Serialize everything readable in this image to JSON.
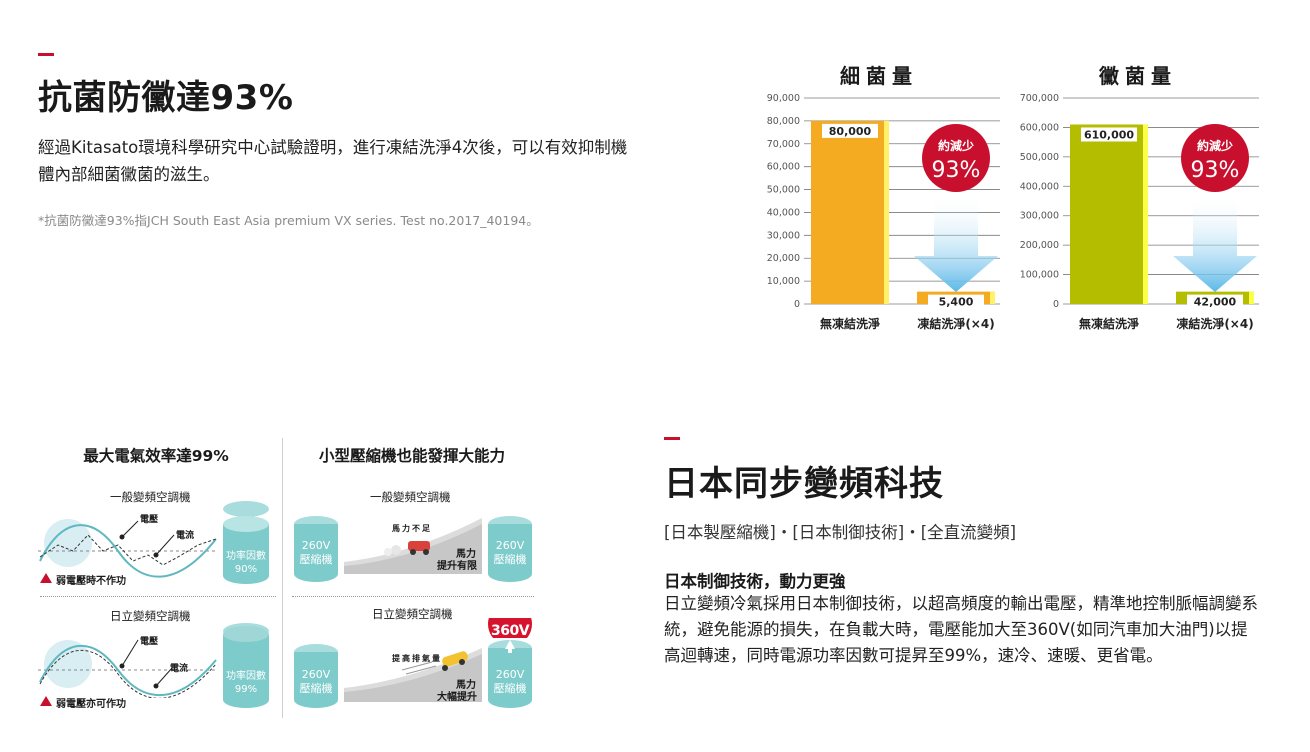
{
  "section1": {
    "title": "抗菌防黴達93%",
    "body": "經過Kitasato環境科學研究中心試驗證明，進行凍結洗淨4次後，可以有效抑制機體內部細菌黴菌的滋生。",
    "note": "*抗菌防黴達93%指JCH South East Asia premium VX series. Test no.2017_40194。"
  },
  "chart_data": [
    {
      "type": "bar",
      "title": "細菌量",
      "categories": [
        "無凍結洗淨",
        "凍結洗淨(×4)"
      ],
      "values": [
        80000,
        5400
      ],
      "value_labels": [
        "80,000",
        "5,400"
      ],
      "ylim": [
        0,
        90000
      ],
      "yticks": [
        "0",
        "10,000",
        "20,000",
        "30,000",
        "40,000",
        "50,000",
        "60,000",
        "70,000",
        "80,000",
        "90,000"
      ],
      "bar_color": "#f4ab22",
      "badge_line1": "約減少",
      "badge_line2": "93%"
    },
    {
      "type": "bar",
      "title": "黴菌量",
      "categories": [
        "無凍結洗淨",
        "凍結洗淨(×4)"
      ],
      "values": [
        610000,
        42000
      ],
      "value_labels": [
        "610,000",
        "42,000"
      ],
      "ylim": [
        0,
        700000
      ],
      "yticks": [
        "0",
        "100,000",
        "200,000",
        "300,000",
        "400,000",
        "500,000",
        "600,000",
        "700,000"
      ],
      "bar_color": "#b5bd00",
      "badge_line1": "約減少",
      "badge_line2": "93%"
    }
  ],
  "section2": {
    "left": {
      "title": "最大電氣效率達99%",
      "top_label": "一般變頻空調機",
      "top_voltage": "電壓",
      "top_current": "電流",
      "top_cyl_line1": "功率因數",
      "top_cyl_line2": "90%",
      "top_warn": "弱電壓時不作功",
      "bottom_label": "日立變頻空調機",
      "bottom_voltage": "電壓",
      "bottom_current": "電流",
      "bottom_cyl_line1": "功率因數",
      "bottom_cyl_line2": "99%",
      "bottom_warn": "弱電壓亦可作功"
    },
    "right": {
      "title": "小型壓縮機也能發揮大能力",
      "top_label": "一般變頻空調機",
      "top_cyl_a_line1": "260V",
      "top_cyl_a_line2": "壓縮機",
      "top_hill_note": "馬力不足",
      "top_power_line1": "馬力",
      "top_power_line2": "提升有限",
      "top_cyl_b_line1": "260V",
      "top_cyl_b_line2": "壓縮機",
      "bottom_label": "日立變頻空調機",
      "bottom_cyl_a_line1": "260V",
      "bottom_cyl_a_line2": "壓縮機",
      "bottom_hill_note": "提高排氣量",
      "bottom_power_line1": "馬力",
      "bottom_power_line2": "大幅提升",
      "bottom_cyl_b_line1": "260V",
      "bottom_cyl_b_line2": "壓縮機",
      "badge": "360V"
    }
  },
  "section3": {
    "title": "日本同步變頻科技",
    "tags": "[日本製壓縮機]・[日本制御技術]・[全直流變頻]",
    "subtitle": "日本制御技術，動力更強",
    "body": "日立變頻冷氣採用日本制御技術，以超高頻度的輸出電壓，精準地控制脈幅調變系統，避免能源的損失，在負載大時，電壓能加大至360V(如同汽車加大油門)以提高迴轉速，同時電源功率因數可提昇至99%，速冷、速暖、更省電。"
  },
  "colors": {
    "accent_red": "#c8102e",
    "teal": "#7ecbcb",
    "arrow_blue": "#5bb8e8"
  }
}
